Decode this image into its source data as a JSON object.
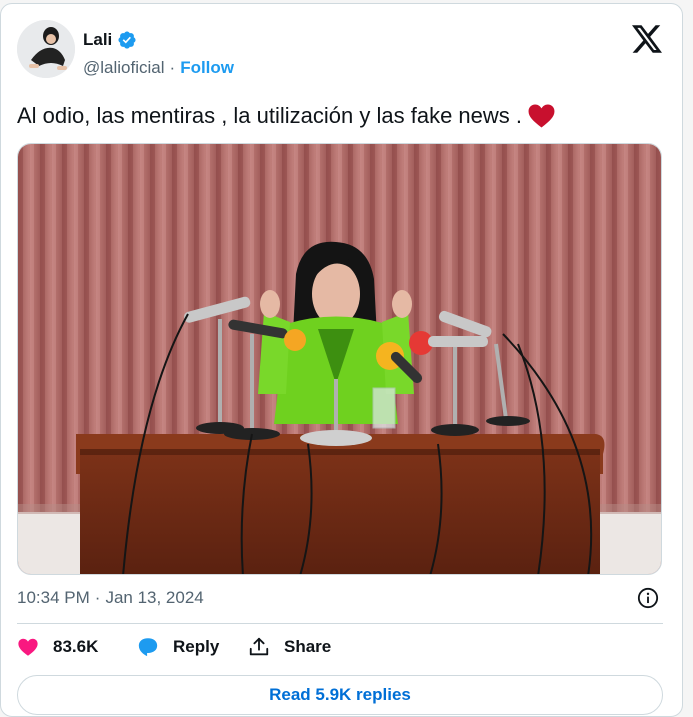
{
  "author": {
    "display_name": "Lali",
    "handle": "@lalioficial",
    "separator": "·",
    "follow_label": "Follow",
    "verified": true
  },
  "tweet": {
    "text": "Al odio, las mentiras , la utilización y las fake news .",
    "emoji": "heart"
  },
  "meta": {
    "time": "10:34 PM",
    "separator": "·",
    "date": "Jan 13, 2024"
  },
  "actions": {
    "likes_count": "83.6K",
    "reply_label": "Reply",
    "share_label": "Share",
    "read_replies_label": "Read 5.9K replies"
  },
  "colors": {
    "accent": "#1d9bf0",
    "like": "#f91880",
    "link_text": "#006fd6",
    "muted": "#536471",
    "curtain": "#b76f6c",
    "wood": "#6f2a14",
    "jacket": "#6fd11f"
  },
  "icons": {
    "logo": "x-logo-icon",
    "verified": "verified-badge-icon",
    "info": "info-icon",
    "like": "heart-icon",
    "reply": "reply-bubble-icon",
    "share": "share-icon"
  }
}
